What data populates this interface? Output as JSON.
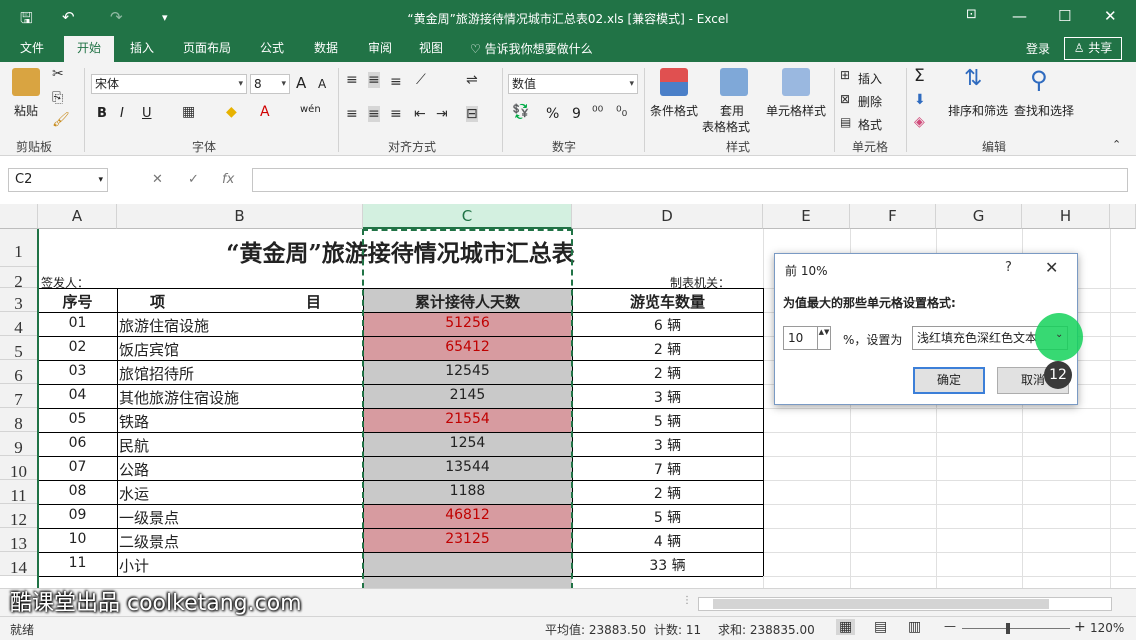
{
  "window": {
    "title": "“黄金周”旅游接待情况城市汇总表02.xls  [兼容模式] - Excel",
    "qa_save": "🖫",
    "qa_undo": "↶",
    "qa_redo": "↷",
    "qa_more": "▾",
    "win_ribbon": "⊡",
    "win_min": "—",
    "win_max": "☐",
    "win_close": "✕"
  },
  "tabs": [
    {
      "label": "文件"
    },
    {
      "label": "开始"
    },
    {
      "label": "插入"
    },
    {
      "label": "页面布局"
    },
    {
      "label": "公式"
    },
    {
      "label": "数据"
    },
    {
      "label": "审阅"
    },
    {
      "label": "视图"
    }
  ],
  "tell_me": "♡ 告诉我你想要做什么",
  "login": "登录",
  "share": "♙ 共享",
  "ribbon": {
    "clipboard": {
      "paste": "粘贴",
      "label": "剪贴板"
    },
    "font": {
      "name": "宋体",
      "size": "8",
      "bold": "B",
      "italic": "I",
      "underline": "U",
      "grow": "A",
      "shrink": "A",
      "wen": "wén",
      "label": "字体"
    },
    "align": {
      "label": "对齐方式"
    },
    "number": {
      "format": "数值",
      "label": "数字",
      "pct": "%",
      "comma": "9"
    },
    "styles": {
      "cond": "条件格式",
      "table1": "套用",
      "table2": "表格格式",
      "cell": "单元格样式",
      "label": "样式"
    },
    "cells": {
      "insert": "插入",
      "delete": "删除",
      "format": "格式",
      "label": "单元格"
    },
    "editing": {
      "sort": "排序和筛选",
      "find": "查找和选择",
      "label": "编辑",
      "sum": "Σ"
    }
  },
  "formula_bar": {
    "name_box": "C2",
    "cancel": "✕",
    "enter": "✓",
    "fx": "fx",
    "value": ""
  },
  "columns": [
    "A",
    "B",
    "C",
    "D",
    "E",
    "F",
    "G",
    "H"
  ],
  "rows": [
    "1",
    "2",
    "3",
    "4",
    "5",
    "6",
    "7",
    "8",
    "9",
    "10",
    "11",
    "12",
    "13",
    "14"
  ],
  "sheet": {
    "title": "“黄金周”旅游接待情况城市汇总表",
    "sender": "签发人：",
    "issuer": "制表机关：",
    "headers": {
      "no": "序号",
      "item_a": "项",
      "item_b": "目",
      "total": "累计接待人天数",
      "cars": "游览车数量"
    },
    "records": [
      {
        "no": "01",
        "item": "旅游住宿设施",
        "total": "51256",
        "cars": "6 辆",
        "hl": true
      },
      {
        "no": "02",
        "item": "饭店宾馆",
        "total": "65412",
        "cars": "2 辆",
        "hl": true
      },
      {
        "no": "03",
        "item": "旅馆招待所",
        "total": "12545",
        "cars": "2 辆",
        "hl": false
      },
      {
        "no": "04",
        "item": "其他旅游住宿设施",
        "total": "2145",
        "cars": "3 辆",
        "hl": false
      },
      {
        "no": "05",
        "item": "铁路",
        "total": "21554",
        "cars": "5 辆",
        "hl": true
      },
      {
        "no": "06",
        "item": "民航",
        "total": "1254",
        "cars": "3 辆",
        "hl": false
      },
      {
        "no": "07",
        "item": "公路",
        "total": "13544",
        "cars": "7 辆",
        "hl": false
      },
      {
        "no": "08",
        "item": "水运",
        "total": "1188",
        "cars": "2 辆",
        "hl": false
      },
      {
        "no": "09",
        "item": "一级景点",
        "total": "46812",
        "cars": "5 辆",
        "hl": true
      },
      {
        "no": "10",
        "item": "二级景点",
        "total": "23125",
        "cars": "4 辆",
        "hl": true
      },
      {
        "no": "11",
        "item": "小计",
        "total": "",
        "cars": "33 辆",
        "hl": false
      }
    ]
  },
  "dialog": {
    "title": "前 10%",
    "help": "?",
    "close": "✕",
    "prompt": "为值最大的那些单元格设置格式:",
    "count": "10",
    "spin": "▲▼",
    "pct_label": "%，设置为",
    "format_option": "浅红填充色深红色文本",
    "ok": "确定",
    "cancel": "取消",
    "step": "12"
  },
  "status": {
    "ready": "就绪",
    "average": "平均值: 23883.50",
    "count": "计数: 11",
    "sum": "求和: 238835.00",
    "zoom": "120%",
    "zoom_minus": "—",
    "zoom_plus": "+"
  },
  "watermark": "酷课堂出品 coolketang.com",
  "colors": {
    "excel_green": "#217346",
    "highlight_fill": "#d79ba0",
    "highlight_text": "#c00000",
    "selected_fill": "#c9c9c9"
  }
}
